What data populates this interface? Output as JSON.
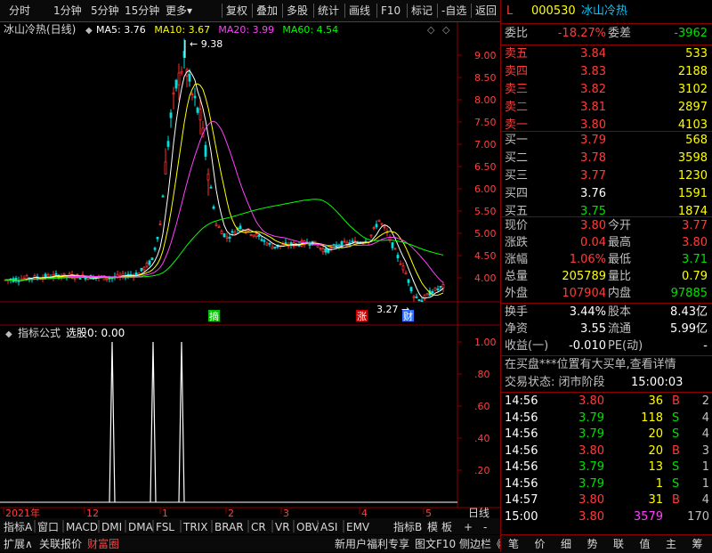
{
  "toolbar": {
    "left": [
      "分时",
      "1分钟",
      "5分钟",
      "15分钟",
      "更多"
    ],
    "right": [
      "复权",
      "叠加",
      "多股",
      "统计",
      "画线",
      "F10",
      "标记",
      "-自选",
      "返回"
    ]
  },
  "main_chart": {
    "title": "冰山冷热(日线)",
    "ma_labels": [
      {
        "text": "MA5: 3.76",
        "color": "#ffffff"
      },
      {
        "text": "MA10: 3.67",
        "color": "#ffff00"
      },
      {
        "text": "MA20: 3.99",
        "color": "#ff40ff"
      },
      {
        "text": "MA60: 4.54",
        "color": "#00ff00"
      }
    ],
    "y_ticks": [
      "9.00",
      "8.50",
      "8.00",
      "7.50",
      "7.00",
      "6.50",
      "6.00",
      "5.50",
      "5.00",
      "4.50",
      "4.00"
    ],
    "high_annotation": "9.38",
    "low_annotation": "3.27",
    "markers": [
      {
        "text": "摘",
        "color": "#00c000"
      },
      {
        "text": "涨",
        "color": "#d00000"
      },
      {
        "text": "财",
        "color": "#3070ff"
      }
    ]
  },
  "indicator": {
    "title": "指标公式",
    "subtitle": "选股0: 0.00",
    "y_ticks": [
      "1.00",
      ".80",
      ".60",
      ".40",
      ".20"
    ]
  },
  "time_axis": {
    "labels": [
      "2021年",
      "12",
      "1",
      "2",
      "3",
      "4",
      "5"
    ],
    "right_label": "日线"
  },
  "bottom_tabs": [
    "指标A",
    "窗口",
    "MACD",
    "DMI",
    "DMA",
    "FSL",
    "TRIX",
    "BRAR",
    "CR",
    "VR",
    "OBV",
    "ASI",
    "EMV",
    "指标B",
    "模",
    "板",
    "+",
    "-"
  ],
  "status_bar": {
    "left": [
      "扩展∧",
      "关联报价",
      "财富圈"
    ],
    "right": [
      "新用户福利专享",
      "图文F10",
      "侧边栏《"
    ]
  },
  "quote": {
    "flag": "L",
    "code": "000530",
    "name": "冰山冷热",
    "weibi_label": "委比",
    "weibi": "-18.27%",
    "weicha_label": "委差",
    "weicha": "-3962",
    "asks": [
      {
        "label": "卖五",
        "price": "3.84",
        "vol": "533"
      },
      {
        "label": "卖四",
        "price": "3.83",
        "vol": "2188"
      },
      {
        "label": "卖三",
        "price": "3.82",
        "vol": "3102"
      },
      {
        "label": "卖二",
        "price": "3.81",
        "vol": "2897"
      },
      {
        "label": "卖一",
        "price": "3.80",
        "vol": "4103"
      }
    ],
    "bids": [
      {
        "label": "买一",
        "price": "3.79",
        "vol": "568"
      },
      {
        "label": "买二",
        "price": "3.78",
        "vol": "3598"
      },
      {
        "label": "买三",
        "price": "3.77",
        "vol": "1230"
      },
      {
        "label": "买四",
        "price": "3.76",
        "vol": "1591"
      },
      {
        "label": "买五",
        "price": "3.75",
        "vol": "1874"
      }
    ],
    "stats": [
      {
        "l1": "现价",
        "v1": "3.80",
        "l2": "今开",
        "v2": "3.77"
      },
      {
        "l1": "涨跌",
        "v1": "0.04",
        "l2": "最高",
        "v2": "3.80"
      },
      {
        "l1": "涨幅",
        "v1": "1.06%",
        "l2": "最低",
        "v2": "3.71"
      },
      {
        "l1": "总量",
        "v1": "205789",
        "l2": "量比",
        "v2": "0.79"
      },
      {
        "l1": "外盘",
        "v1": "107904",
        "l2": "内盘",
        "v2": "97885"
      }
    ],
    "fund": [
      {
        "l1": "换手",
        "v1": "3.44%",
        "l2": "股本",
        "v2": "8.43亿"
      },
      {
        "l1": "净资",
        "v1": "3.55",
        "l2": "流通",
        "v2": "5.99亿"
      },
      {
        "l1": "收益(一)",
        "v1": "-0.010",
        "l2": "PE(动)",
        "v2": "-"
      }
    ],
    "notice": "在买盘***位置有大买单,查看详情",
    "trade_state_label": "交易状态: 闭市阶段",
    "trade_state_time": "15:00:03",
    "ticks": [
      {
        "t": "14:56",
        "p": "3.80",
        "v": "36",
        "s": "B",
        "n": "2"
      },
      {
        "t": "14:56",
        "p": "3.79",
        "v": "118",
        "s": "S",
        "n": "4"
      },
      {
        "t": "14:56",
        "p": "3.79",
        "v": "20",
        "s": "S",
        "n": "4"
      },
      {
        "t": "14:56",
        "p": "3.80",
        "v": "20",
        "s": "B",
        "n": "3"
      },
      {
        "t": "14:56",
        "p": "3.79",
        "v": "13",
        "s": "S",
        "n": "1"
      },
      {
        "t": "14:56",
        "p": "3.79",
        "v": "1",
        "s": "S",
        "n": "1"
      },
      {
        "t": "14:57",
        "p": "3.80",
        "v": "31",
        "s": "B",
        "n": "4"
      },
      {
        "t": "15:00",
        "p": "3.80",
        "v": "3579",
        "s": "",
        "n": "170"
      }
    ],
    "bottom_icons": [
      "笔",
      "价",
      "细",
      "势",
      "联",
      "值",
      "主",
      "筹"
    ]
  }
}
